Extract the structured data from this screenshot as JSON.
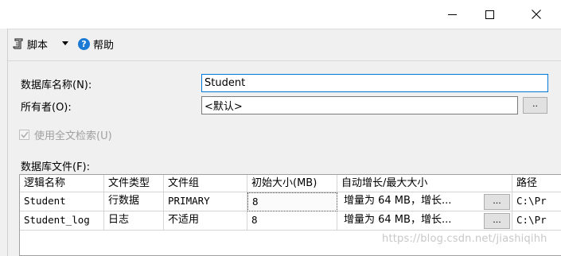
{
  "window": {
    "buttons": [
      "minimize",
      "maximize",
      "close"
    ]
  },
  "toolbar": {
    "script_label": "脚本",
    "help_label": "帮助",
    "help_glyph": "?"
  },
  "form": {
    "db_name_label": "数据库名称(N):",
    "db_name_value": "Student",
    "owner_label": "所有者(O):",
    "owner_value": "<默认>",
    "owner_browse": "..",
    "fulltext_label": "使用全文检索(U)",
    "files_label": "数据库文件(F):"
  },
  "files_table": {
    "headers": [
      "逻辑名称",
      "文件类型",
      "文件组",
      "初始大小(MB)",
      "自动增长/最大大小",
      "路径"
    ],
    "rows": [
      {
        "logical_name": "Student",
        "file_type": "行数据",
        "filegroup": "PRIMARY",
        "initial_size": "8",
        "autogrowth": "增量为 64 MB，增长...",
        "browse": "...",
        "path": "C:\\Pr"
      },
      {
        "logical_name": "Student_log",
        "file_type": "日志",
        "filegroup": "不适用",
        "initial_size": "8",
        "autogrowth": "增量为 64 MB，增长...",
        "browse": "...",
        "path": "C:\\Pr"
      }
    ]
  },
  "watermark": "https://blog.csdn.net/jiashiqihh",
  "colors": {
    "accent": "#0078d7",
    "panel": "#f0f0f0",
    "help_icon": "#1a7ad4"
  }
}
